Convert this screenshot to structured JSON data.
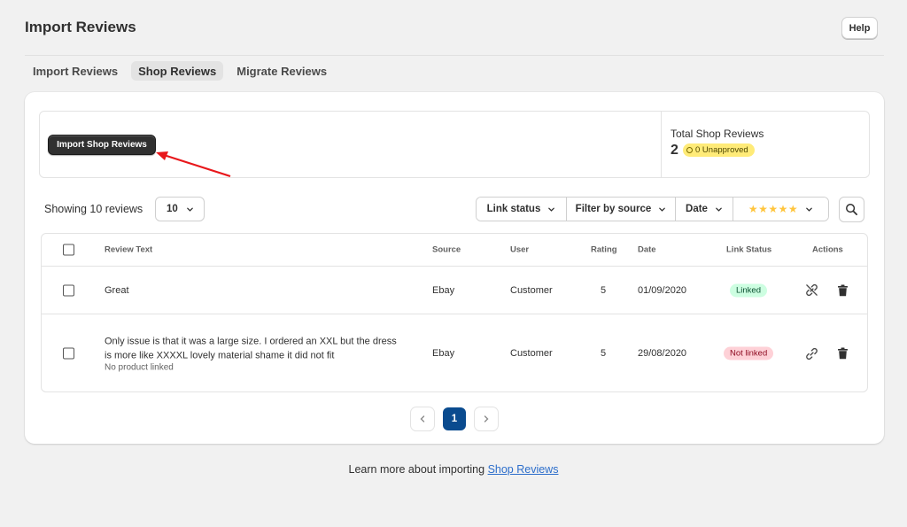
{
  "page": {
    "title": "Import Reviews",
    "help_label": "Help"
  },
  "tabs": [
    {
      "label": "Import Reviews",
      "active": false
    },
    {
      "label": "Shop Reviews",
      "active": true
    },
    {
      "label": "Migrate Reviews",
      "active": false
    }
  ],
  "summary": {
    "import_button": "Import Shop Reviews",
    "total_label": "Total Shop Reviews",
    "total_count": "2",
    "unapproved_badge": "0 Unapproved"
  },
  "toolbar": {
    "showing_text": "Showing 10 reviews",
    "per_page": "10",
    "filters": [
      "Link status",
      "Filter by source",
      "Date"
    ],
    "rating_filter_stars": "★★★★★",
    "star_color": "#ffc53d"
  },
  "table": {
    "headers": {
      "review_text": "Review Text",
      "source": "Source",
      "user": "User",
      "rating": "Rating",
      "date": "Date",
      "link_status": "Link Status",
      "actions": "Actions"
    },
    "rows": [
      {
        "review_text": "Great",
        "sub_text": "",
        "source": "Ebay",
        "user": "Customer",
        "rating": "5",
        "date": "01/09/2020",
        "link_status": "Linked",
        "link_icon": "unlink-icon"
      },
      {
        "review_text": "Only issue is that it was a large size. I ordered an XXL but the dress is more like XXXXL lovely material shame it did not fit",
        "sub_text": "No product linked",
        "source": "Ebay",
        "user": "Customer",
        "rating": "5",
        "date": "29/08/2020",
        "link_status": "Not linked",
        "link_icon": "link-icon"
      }
    ]
  },
  "pagination": {
    "current_page": "1"
  },
  "footer": {
    "text": "Learn more about importing ",
    "link": "Shop Reviews"
  },
  "colors": {
    "primary_button": "#303030",
    "active_page": "#0a4b8f",
    "linked_badge": "#cdfee1",
    "not_linked_badge": "#fed1d7",
    "unapproved_badge": "#ffeb78",
    "annotation_arrow": "#e8171b",
    "link": "#2c6ecb"
  }
}
